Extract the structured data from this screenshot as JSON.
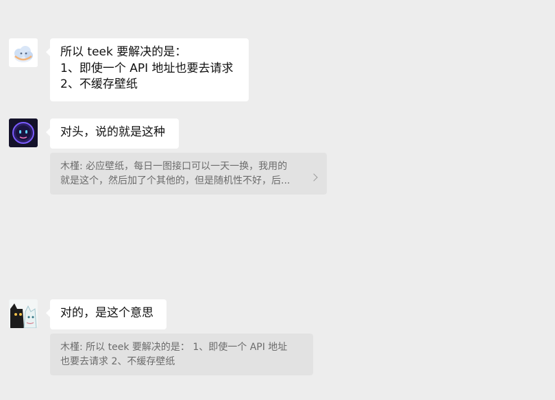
{
  "messages": [
    {
      "avatar": "cloud-avatar",
      "lines": [
        "所以 teek 要解决的是：",
        "1、即使一个 API 地址也要去请求",
        "2、不缓存壁纸"
      ]
    },
    {
      "avatar": "robot-avatar",
      "lines": [
        "对头，说的就是这种"
      ],
      "quote": {
        "lines": [
          "木槿: 必应壁纸，每日一图接口可以一天一换，我用的",
          "就是这个，然后加了个其他的，但是随机性不好，后..."
        ],
        "expandable": true
      }
    },
    {
      "avatar": "cat-avatar",
      "lines": [
        "对的，是这个意思"
      ],
      "quote": {
        "lines": [
          "木槿: 所以 teek 要解决的是：  1、即使一个 API 地址",
          "也要去请求 2、不缓存壁纸"
        ],
        "expandable": false
      }
    }
  ],
  "colors": {
    "background": "#ededed",
    "bubble": "#ffffff",
    "quote": "#e2e2e2",
    "quote_text": "#6b6b6b"
  }
}
